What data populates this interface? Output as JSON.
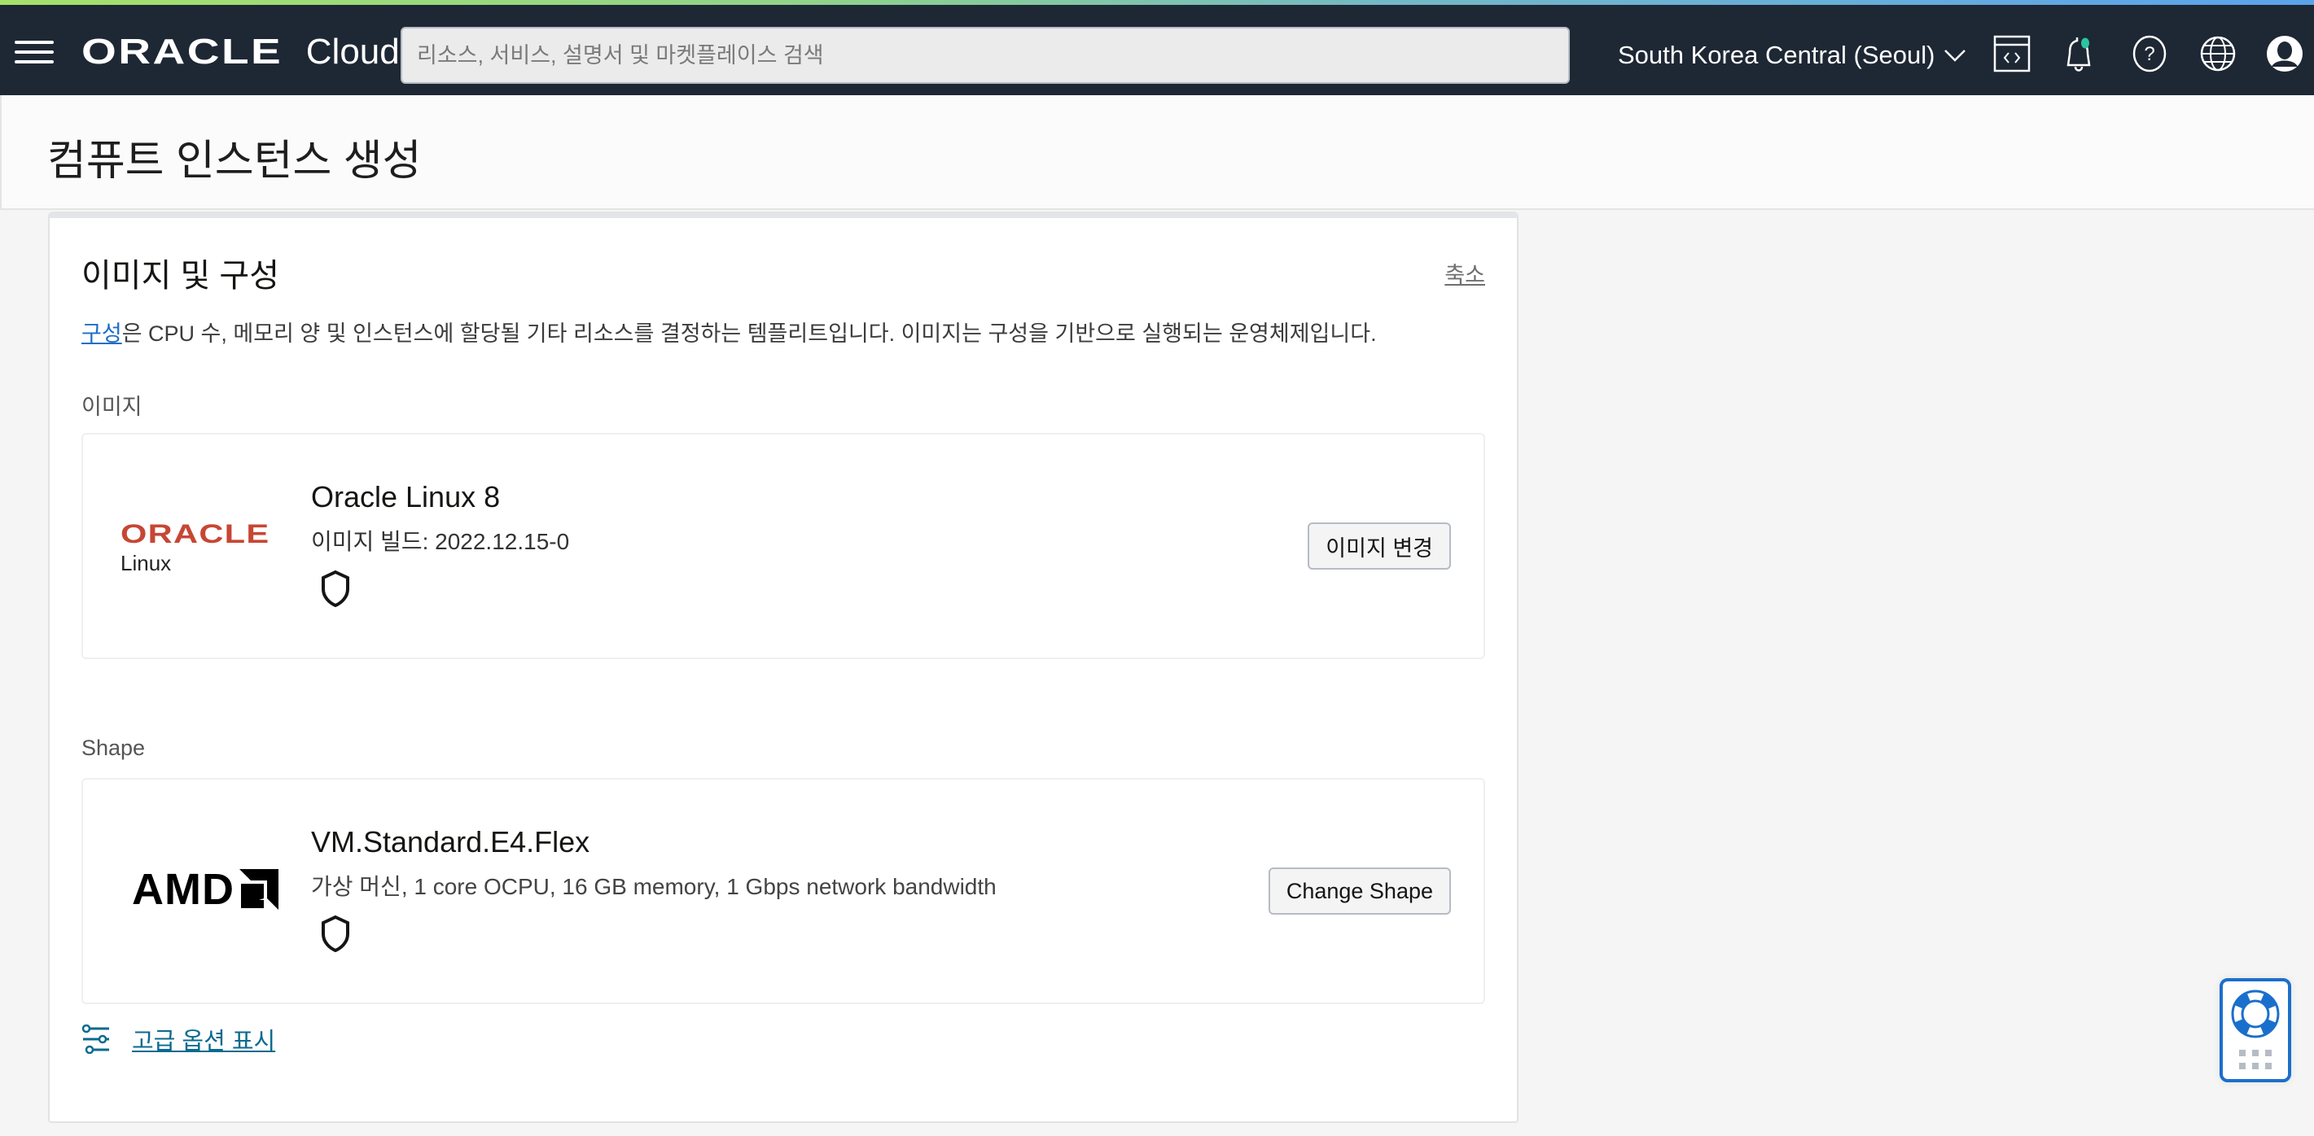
{
  "header": {
    "brand": "ORACLE",
    "product": "Cloud",
    "search_placeholder": "리소스, 서비스, 설명서 및 마켓플레이스 검색",
    "region": "South Korea Central (Seoul)",
    "icons": [
      "menu-icon",
      "code-editor-icon",
      "notification-bell-icon",
      "help-icon",
      "language-globe-icon",
      "user-profile-icon"
    ],
    "notification_dot_color": "#2bc5a0"
  },
  "page": {
    "title": "컴퓨트 인스턴스 생성"
  },
  "section": {
    "title": "이미지 및 구성",
    "collapse_label": "축소",
    "description_link": "구성",
    "description_text": "은 CPU 수, 메모리 양 및 인스턴스에 할당될 기타 리소스를 결정하는 템플리트입니다. 이미지는 구성을 기반으로 실행되는 운영체제입니다.",
    "image": {
      "label": "이미지",
      "logo_brand": "ORACLE",
      "logo_sub": "Linux",
      "name": "Oracle Linux 8",
      "build": "이미지 빌드: 2022.12.15-0",
      "button": "이미지 변경"
    },
    "shape": {
      "label": "Shape",
      "logo_brand": "AMD",
      "name": "VM.Standard.E4.Flex",
      "detail": "가상 머신, 1 core OCPU, 16 GB memory, 1 Gbps network bandwidth",
      "button": "Change Shape"
    },
    "advanced_link": "고급 옵션 표시"
  },
  "colors": {
    "navbar": "#1e2734",
    "oracle_red": "#c74634",
    "link_blue": "#1e6ec8",
    "advanced_link": "#0a6a8f",
    "help_widget_blue": "#1b6fcc"
  }
}
